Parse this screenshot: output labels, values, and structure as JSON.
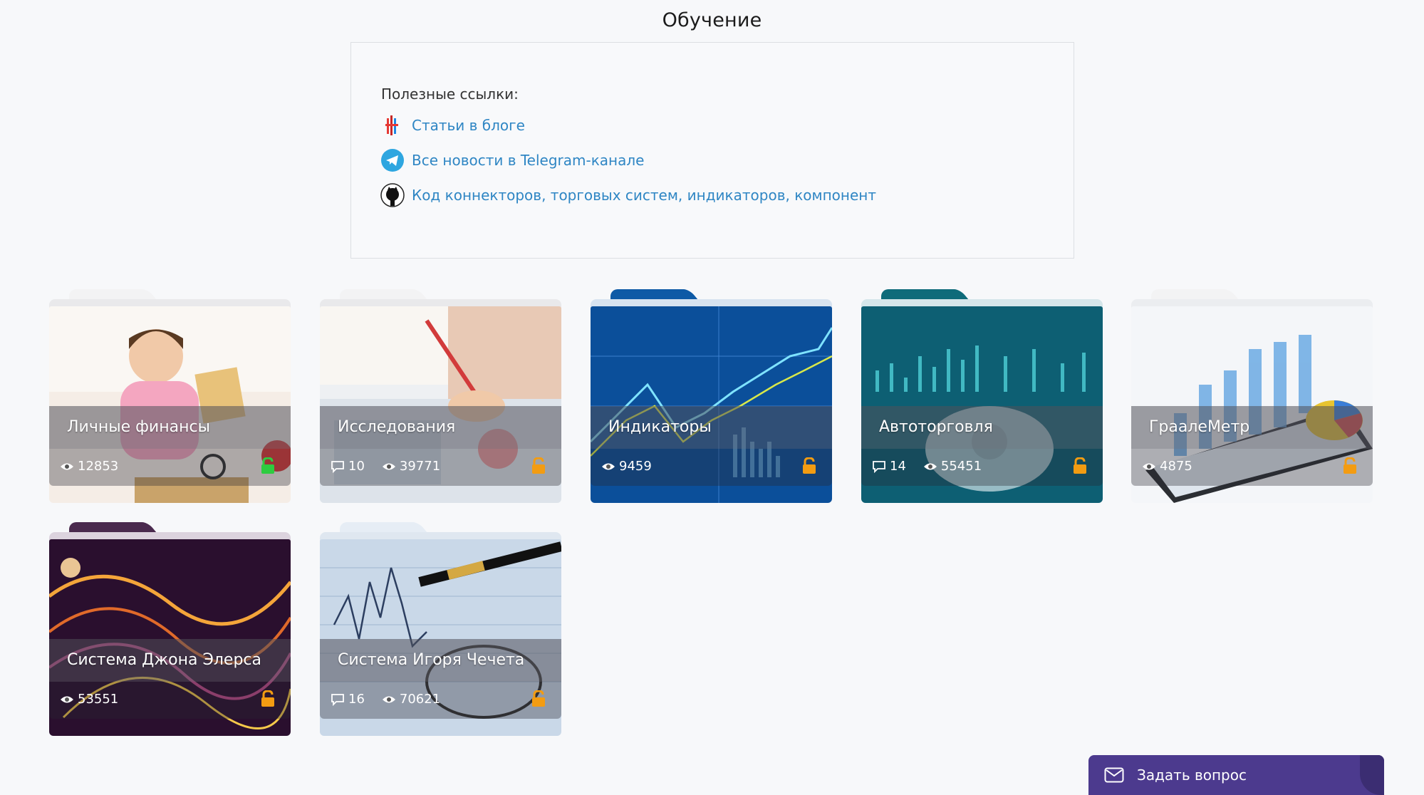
{
  "page": {
    "title": "Обучение"
  },
  "links": {
    "heading": "Полезные ссылки:",
    "items": [
      {
        "label": "Статьи в блоге",
        "icon": "blog-logo-icon"
      },
      {
        "label": "Все новости в Telegram-канале",
        "icon": "telegram-icon"
      },
      {
        "label": "Код коннекторов, торговых систем, индикаторов, компонент",
        "icon": "github-icon"
      }
    ]
  },
  "cards": [
    {
      "title": "Личные финансы",
      "comments": null,
      "views": "12853",
      "lock": "green"
    },
    {
      "title": "Исследования",
      "comments": "10",
      "views": "39771",
      "lock": "orange"
    },
    {
      "title": "Индикаторы",
      "comments": null,
      "views": "9459",
      "lock": "orange"
    },
    {
      "title": "Автоторговля",
      "comments": "14",
      "views": "55451",
      "lock": "orange"
    },
    {
      "title": "ГраалеМетр",
      "comments": null,
      "views": "4875",
      "lock": "orange"
    },
    {
      "title": "Система Джона Элерса",
      "comments": null,
      "views": "53551",
      "lock": "orange"
    },
    {
      "title": "Система Игоря Чечета",
      "comments": "16",
      "views": "70621",
      "lock": "orange"
    }
  ],
  "ask": {
    "label": "Задать вопрос"
  },
  "colors": {
    "link": "#2f86c4",
    "ask_bg": "#4c3a8e",
    "lock_orange": "#f39c12",
    "lock_green": "#2ecc40"
  }
}
